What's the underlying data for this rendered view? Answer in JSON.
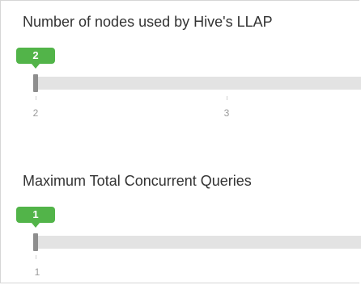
{
  "llap_nodes": {
    "title": "Number of nodes used by Hive's LLAP",
    "value": "2",
    "slider_position_fraction": 0,
    "ticks": [
      "2",
      "3"
    ]
  },
  "max_concurrent_queries": {
    "title": "Maximum Total Concurrent Queries",
    "value": "1",
    "slider_position_fraction": 0,
    "ticks": [
      "1"
    ]
  },
  "colors": {
    "badge": "#52b449",
    "track": "#e3e3e3",
    "handle": "#8e8e8e",
    "tick_text": "#9a9a9a",
    "title_text": "#333333"
  }
}
